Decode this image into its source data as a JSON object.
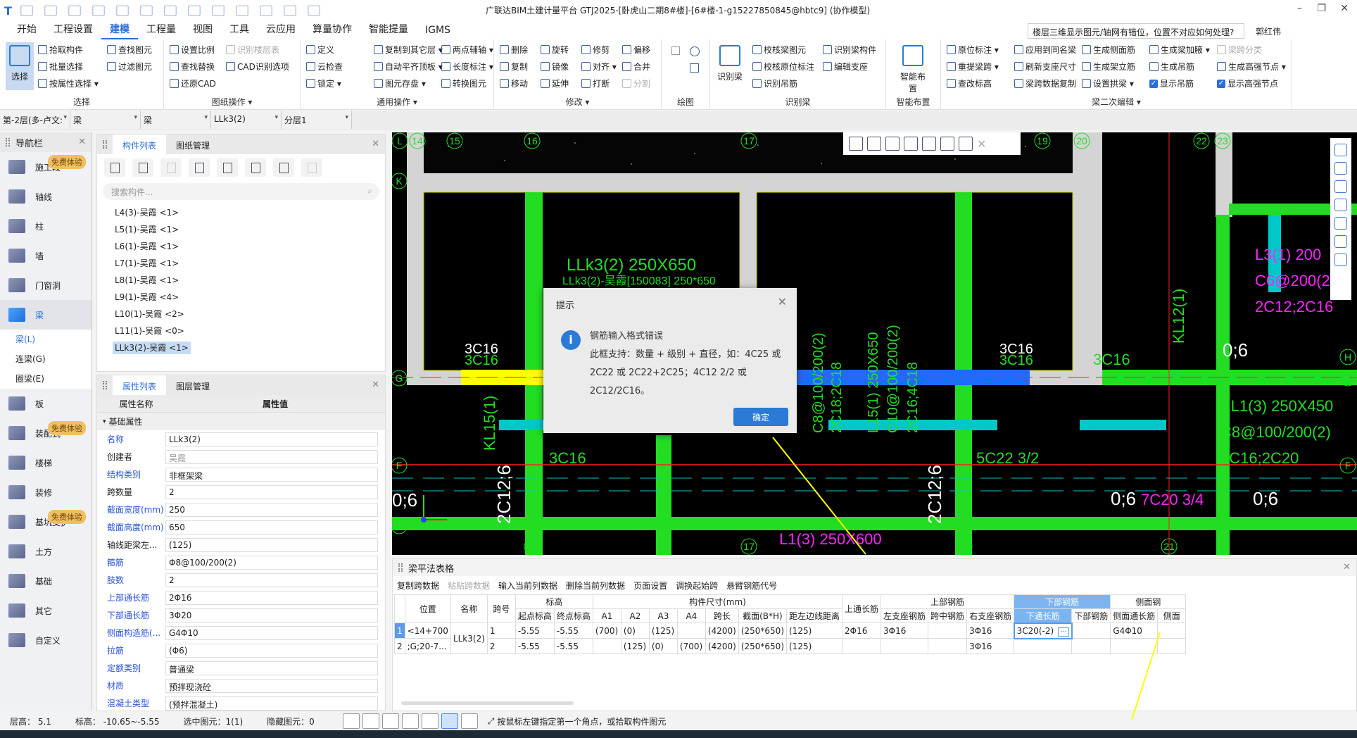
{
  "app": {
    "title": "广联达BIM土建计量平台 GTJ2025-[卧虎山二期8#楼]-[6#楼-1-g15227850845@hbtc9]  (协作模型)",
    "help_search": "楼层三维显示图元/轴网有错位，位置不对应如何处理?",
    "user": "郭红伟",
    "window_controls": [
      "–",
      "❐",
      "✕"
    ]
  },
  "menu": [
    "开始",
    "工程设置",
    "建模",
    "工程量",
    "视图",
    "工具",
    "云应用",
    "算量协作",
    "智能提量",
    "IGMS"
  ],
  "menu_active": "建模",
  "ribbon": {
    "select": {
      "label": "选择",
      "big": "选择",
      "items": [
        "拾取构件",
        "批量选择",
        "按属性选择 ▾",
        "查找图元",
        "过滤图元"
      ]
    },
    "drawing": {
      "label": "图纸操作 ▾",
      "items": [
        "设置比例",
        "识别楼层表",
        "查找替换",
        "CAD识别选项",
        "还原CAD"
      ]
    },
    "common": {
      "label": "通用操作 ▾",
      "items": [
        "定义",
        "复制到其它层 ▾",
        "两点辅轴 ▾",
        "云检查",
        "自动平齐顶板 ▾",
        "长度标注 ▾",
        "锁定 ▾",
        "图元存盘 ▾",
        "转换图元"
      ]
    },
    "modify": {
      "label": "修改 ▾",
      "items": [
        "删除",
        "旋转",
        "修剪",
        "偏移",
        "复制",
        "镜像",
        "对齐 ▾",
        "合并",
        "移动",
        "延伸",
        "打断",
        "分割"
      ]
    },
    "draw": {
      "label": "绘图"
    },
    "recognize": {
      "label": "识别梁",
      "big": "识别梁",
      "items": [
        "校核梁图元",
        "识别梁构件",
        "校核原位标注",
        "编辑支座",
        "识别吊筋"
      ]
    },
    "smart": {
      "label": "智能布置",
      "big": "智能布置"
    },
    "beam_edit": {
      "label": "梁二次编辑 ▾",
      "items": [
        "原位标注 ▾",
        "应用到同名梁",
        "生成侧面筋",
        "生成梁加腋 ▾",
        "梁跨分类",
        "重提梁跨 ▾",
        "刷新支座尺寸",
        "生成架立筋",
        "生成吊筋",
        "生成高强节点 ▾",
        "查改标高",
        "梁跨数据复制",
        "设置拱梁 ▾"
      ],
      "checks": [
        "显示吊筋",
        "显示高强节点"
      ]
    }
  },
  "dropdowns": [
    "第-2层(多-卢文:",
    "梁",
    "梁",
    "LLk3(2)",
    "分层1"
  ],
  "nav": {
    "title": "导航栏",
    "badge": "免费体验",
    "items": [
      "施工段",
      "轴线",
      "柱",
      "墙",
      "门窗洞",
      "梁"
    ],
    "sub": [
      "梁(L)",
      "连梁(G)",
      "圈梁(E)"
    ],
    "items2": [
      "板",
      "装配式",
      "楼梯",
      "装修",
      "基坑支护",
      "土方",
      "基础",
      "其它",
      "自定义"
    ]
  },
  "components": {
    "tabs": [
      "构件列表",
      "图纸管理"
    ],
    "search_placeholder": "搜索构件...",
    "items": [
      "L4(3)-吴霞 <1>",
      "L5(1)-吴霞 <1>",
      "L6(1)-吴霞 <1>",
      "L7(1)-吴霞 <1>",
      "L8(1)-吴霞 <1>",
      "L9(1)-吴霞 <4>",
      "L10(1)-吴霞 <2>",
      "L11(1)-吴霞 <0>",
      "LLk3(2)-吴霞 <1>"
    ],
    "selected": "LLk3(2)-吴霞 <1>"
  },
  "properties": {
    "tabs": [
      "属性列表",
      "图层管理"
    ],
    "col_name": "属性名称",
    "col_value": "属性值",
    "group": "基础属性",
    "rows": [
      {
        "n": "名称",
        "v": "LLk3(2)",
        "blue": true
      },
      {
        "n": "创建者",
        "v": "吴霞",
        "blue": false,
        "grey": true
      },
      {
        "n": "结构类别",
        "v": "非框架梁",
        "blue": true
      },
      {
        "n": "跨数量",
        "v": "2",
        "blue": false
      },
      {
        "n": "截面宽度(mm)",
        "v": "250",
        "blue": true
      },
      {
        "n": "截面高度(mm)",
        "v": "650",
        "blue": true
      },
      {
        "n": "轴线距梁左...",
        "v": "(125)",
        "blue": false
      },
      {
        "n": "箍筋",
        "v": "Φ8@100/200(2)",
        "blue": true
      },
      {
        "n": "肢数",
        "v": "2",
        "blue": true
      },
      {
        "n": "上部通长筋",
        "v": "2Φ16",
        "blue": true
      },
      {
        "n": "下部通长筋",
        "v": "3Φ20",
        "blue": true
      },
      {
        "n": "侧面构造筋(...",
        "v": "G4Φ10",
        "blue": true
      },
      {
        "n": "拉筋",
        "v": "(Φ6)",
        "blue": true
      },
      {
        "n": "定额类别",
        "v": "普通梁",
        "blue": true
      },
      {
        "n": "材质",
        "v": "预拌现浇砼",
        "blue": true
      },
      {
        "n": "混凝土类型",
        "v": "(预拌混凝土)",
        "blue": true
      }
    ]
  },
  "canvas": {
    "axes_top": [
      "L",
      "14",
      "15",
      "16",
      "17",
      "19",
      "20",
      "22",
      "23"
    ],
    "axes_left": [
      "K",
      "G",
      "F",
      "E"
    ],
    "axes_right": [
      "H",
      "G",
      "F"
    ],
    "axes_bottom": [
      "16",
      "17",
      "18",
      "21"
    ],
    "labels": {
      "llk3": "LLk3(2) 250X650",
      "llk3b": "LLk3(2)-吴霞[150083] 250*650",
      "c16a": "3C16",
      "c16b": "3C16",
      "c16c": "3C16",
      "c16d": "3C16",
      "c16e": "3C16",
      "c16f": "3C16",
      "z6a": "0;6",
      "kl12": "KL12(1)",
      "kl1": "KL1(3) 250X450",
      "kl1b": "C8@100/200(2)",
      "kl1c": "2C16;2C20",
      "l3": "L3(1) 200",
      "l3b": "C6@200(2)",
      "l3c": "2C12;2C16",
      "c22": "5C22 3/2",
      "kl15": "KL15(1)",
      "c12a": "2C12;6",
      "c12b": "2C12;6",
      "z6b": "0;6",
      "z6c": "0;6",
      "c20": "7C20 3/4",
      "z6d": "0;6",
      "l1": "L1(3) 250X600",
      "v1": "C8@100/200(2)",
      "v2": "2C18;2C18",
      "v3": "L15(1) 250X650",
      "v4": "C10@100/200(2)",
      "v5": "2C16;4C18"
    },
    "colors": {
      "beam": "#22dd22",
      "wall": "#d4d4d4",
      "selected": "#1e6cff",
      "highlight": "#ffff00",
      "magenta": "#ff22ff",
      "cyan": "#00c8c8"
    }
  },
  "dialog": {
    "title": "提示",
    "line1": "钢筋输入格式错误",
    "line2": "此框支持：数量 + 级别 + 直径，如：4C25 或 2C22 或 2C22+2C25；4C12 2/2 或 2C12/2C16。",
    "ok": "确定"
  },
  "beam_table": {
    "title": "梁平法表格",
    "tools": [
      "复制跨数据",
      "粘贴跨数据",
      "输入当前列数据",
      "删除当前列数据",
      "页面设置",
      "调换起始跨",
      "悬臂钢筋代号"
    ],
    "disabled_tool": "粘贴跨数据",
    "h1": {
      "pos": "位置",
      "name": "名称",
      "span": "跨号",
      "elev": "标高",
      "size": "构件尺寸(mm)",
      "top_long": "上通长筋",
      "top": "上部钢筋",
      "bottom": "下部钢筋",
      "side": "侧面钢"
    },
    "h2": [
      "起点标高",
      "终点标高",
      "A1",
      "A2",
      "A3",
      "A4",
      "跨长",
      "截面(B*H)",
      "距左边线距离",
      "左支座钢筋",
      "跨中钢筋",
      "右支座钢筋",
      "下通长筋",
      "下部钢筋",
      "侧面通长筋",
      "侧面"
    ],
    "rows": [
      {
        "idx": "1",
        "pos": "<14+700",
        "cells": [
          "1",
          "-5.55",
          "-5.55",
          "(700)",
          "(0)",
          "(125)",
          "",
          "(4200)",
          "(250*650)",
          "(125)",
          "2Φ16",
          "3Φ16",
          "",
          "3Φ16",
          "3C20(-2)",
          "",
          "G4Φ10",
          ""
        ]
      },
      {
        "idx": "2",
        "pos": ";G;20-7...",
        "cells": [
          "2",
          "-5.55",
          "-5.55",
          "",
          "(125)",
          "(0)",
          "(700)",
          "(4200)",
          "(250*650)",
          "(125)",
          "",
          "",
          "",
          "3Φ16",
          "",
          "",
          "",
          ""
        ]
      }
    ],
    "name": "LLk3(2)",
    "editing_value": "3C20(-2)"
  },
  "status": {
    "floor_h": "层高：  5.1",
    "elev": "标高：  -10.65~-5.55",
    "selected": "选中图元：1(1)",
    "hidden": "隐藏图元：0",
    "hint": "按鼠标左键指定第一个角点，或拾取构件图元"
  }
}
